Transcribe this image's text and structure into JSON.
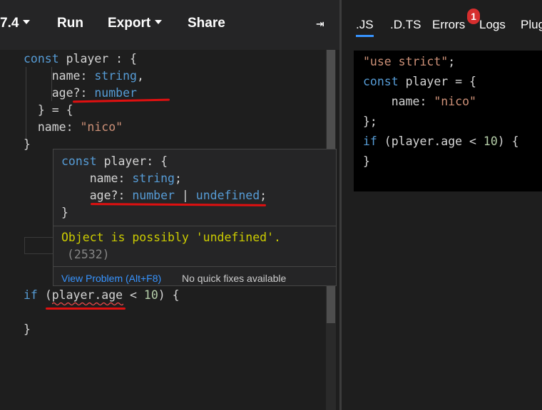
{
  "toolbar": {
    "version": "7.4",
    "run": "Run",
    "export": "Export",
    "share": "Share",
    "collapse_glyph": "⇥"
  },
  "editor": {
    "lines": [
      {
        "t": [
          [
            "const",
            "kw"
          ],
          [
            " player : {",
            ""
          ]
        ]
      },
      {
        "t": [
          [
            "    name: ",
            ""
          ],
          [
            "string",
            "kw"
          ],
          [
            ",",
            ""
          ]
        ]
      },
      {
        "t": [
          [
            "    age?: ",
            ""
          ],
          [
            "number",
            "kw"
          ]
        ]
      },
      {
        "t": [
          [
            "  } = {",
            ""
          ]
        ]
      },
      {
        "t": [
          [
            "  name: ",
            ""
          ],
          [
            "\"nico\"",
            "str"
          ]
        ]
      },
      {
        "t": [
          [
            "}",
            ""
          ]
        ]
      },
      {
        "t": [
          [
            "if ",
            "kw"
          ],
          [
            "(player.age < ",
            ""
          ],
          [
            "10",
            "num"
          ],
          [
            ") {",
            ""
          ]
        ]
      },
      {
        "t": [
          [
            "}",
            ""
          ]
        ]
      }
    ]
  },
  "hover": {
    "code": [
      {
        "t": [
          [
            "const",
            "kw"
          ],
          [
            " player: {",
            ""
          ]
        ]
      },
      {
        "t": [
          [
            "    name: ",
            ""
          ],
          [
            "string",
            "kw"
          ],
          [
            ";",
            ""
          ]
        ]
      },
      {
        "t": [
          [
            "    age?: ",
            ""
          ],
          [
            "number",
            "kw"
          ],
          [
            " | ",
            ""
          ],
          [
            "undefined",
            "kw"
          ],
          [
            ";",
            ""
          ]
        ]
      },
      {
        "t": [
          [
            "}",
            ""
          ]
        ]
      }
    ],
    "error_message": "Object is possibly 'undefined'.",
    "error_code": "(2532)",
    "view_problem": "View Problem (Alt+F8)",
    "quick_fixes": "No quick fixes available"
  },
  "right_panel": {
    "tabs": [
      ".JS",
      ".D.TS",
      "Errors",
      "Logs",
      "Plug"
    ],
    "active_tab": ".JS",
    "error_count": "1",
    "output": [
      {
        "t": [
          [
            "\"use strict\"",
            "str"
          ],
          [
            ";",
            ""
          ]
        ]
      },
      {
        "t": [
          [
            "const",
            "kw"
          ],
          [
            " player = {",
            ""
          ]
        ]
      },
      {
        "t": [
          [
            "    name: ",
            ""
          ],
          [
            "\"nico\"",
            "str"
          ]
        ]
      },
      {
        "t": [
          [
            "};",
            ""
          ]
        ]
      },
      {
        "t": [
          [
            "if",
            "kw"
          ],
          [
            " (player.age < ",
            ""
          ],
          [
            "10",
            "num"
          ],
          [
            ") {",
            ""
          ]
        ]
      },
      {
        "t": [
          [
            "}",
            ""
          ]
        ]
      }
    ]
  },
  "colors": {
    "keyword": "#569cd6",
    "string": "#ce9178",
    "number": "#b5cea8",
    "error_text": "#cccc00",
    "annotation_red": "#e01010",
    "link": "#3794ff"
  }
}
